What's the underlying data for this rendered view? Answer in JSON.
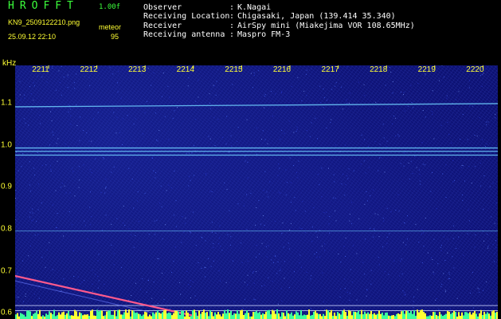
{
  "header": {
    "title": "HROFFT",
    "version": "1.00f",
    "filename": "KN9_2509122210.png",
    "mode": "meteor",
    "datetime": "25.09.12 22:10",
    "count": "95"
  },
  "info": [
    {
      "label": "Observer",
      "value": "K.Nagai"
    },
    {
      "label": "Receiving Location",
      "value": "Chigasaki, Japan (139.414 35.340)"
    },
    {
      "label": "Receiver",
      "value": "AirSpy mini (Miakejima VOR 108.65MHz)"
    },
    {
      "label": "Receiving antenna",
      "value": "Maspro FM-3"
    }
  ],
  "spectrogram": {
    "unit_label": "kHz",
    "time_ticks": [
      "2211",
      "2212",
      "2213",
      "2214",
      "2215",
      "2216",
      "2217",
      "2218",
      "2219",
      "2220"
    ],
    "freq_ticks": [
      "1.1",
      "1.0",
      "0.9",
      "0.8",
      "0.7",
      "0.6"
    ],
    "freq_range": [
      0.585,
      1.19
    ],
    "carrier_lines_khz": [
      1.095,
      0.993,
      0.985,
      0.976,
      0.795
    ],
    "reference_lines_khz": [
      0.617,
      0.605
    ],
    "meteor_trace": {
      "start_minute": 2210.0,
      "start_khz": 0.705,
      "end_minute": 2214.3,
      "end_khz": 0.585
    },
    "colors": {
      "background": "#0b0f6e",
      "carrier": "#6fd0ff",
      "trace": "#ff5a8c",
      "axis_text": "#ffff33",
      "title": "#3cff3c"
    }
  }
}
